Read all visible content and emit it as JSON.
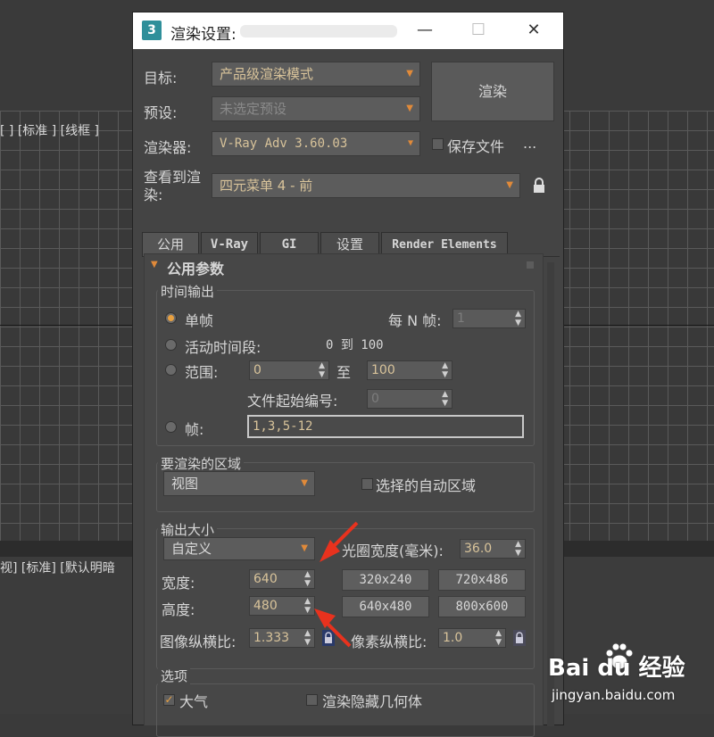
{
  "viewport_top": {
    "label": "[ ] [标准 ] [线框 ]"
  },
  "viewport_bottom": {
    "label": "视] [标准] [默认明暗"
  },
  "dialog": {
    "app_icon": "3",
    "title": "渲染设置:",
    "minimize": "—",
    "maximize": "☐",
    "close": "✕",
    "target_label": "目标:",
    "target_value": "产品级渲染模式",
    "preset_label": "预设:",
    "preset_value": "未选定预设",
    "renderer_label": "渲染器:",
    "renderer_value": "V-Ray Adv 3.60.03",
    "save_file_label": "保存文件",
    "more": "...",
    "view_label": "查看到渲染:",
    "view_label_line1": "查看到渲",
    "view_label_line2": "染:",
    "view_value": "四元菜单 4 - 前",
    "render_button": "渲染",
    "tabs": [
      "公用",
      "V-Ray",
      "GI",
      "设置",
      "Render Elements"
    ]
  },
  "common_params": {
    "rollout_title": "公用参数",
    "time_output": {
      "title": "时间输出",
      "single": "单帧",
      "every_n_label": "每 N 帧:",
      "every_n_value": "1",
      "active_segment": "活动时间段:",
      "active_range": "0 到 100",
      "range": "范围:",
      "range_from": "0",
      "range_to_label": "至",
      "range_to": "100",
      "file_start_label": "文件起始编号:",
      "file_start_value": "0",
      "frames": "帧:",
      "frames_value": "1,3,5-12"
    },
    "area": {
      "title": "要渲染的区域",
      "value": "视图",
      "auto_region": "选择的自动区域"
    },
    "output_size": {
      "title": "输出大小",
      "preset_value": "自定义",
      "aperture_label": "光圈宽度(毫米):",
      "aperture_value": "36.0",
      "width_label": "宽度:",
      "width_value": "640",
      "height_label": "高度:",
      "height_value": "480",
      "presets": [
        "320x240",
        "720x486",
        "640x480",
        "800x600"
      ],
      "image_aspect_label": "图像纵横比:",
      "image_aspect_value": "1.333",
      "pixel_aspect_label": "像素纵横比:",
      "pixel_aspect_value": "1.0"
    },
    "options": {
      "title": "选项",
      "atmosphere": "大气",
      "atmosphere_checked": true,
      "hidden_geometry": "渲染隐藏几何体"
    }
  },
  "watermark": {
    "logo": "Bai du 经验",
    "url": "jingyan.baidu.com"
  },
  "colors": {
    "accent": "#e08a3a",
    "annotation_arrow": "#e8321e",
    "dialog_bg": "#444444"
  }
}
